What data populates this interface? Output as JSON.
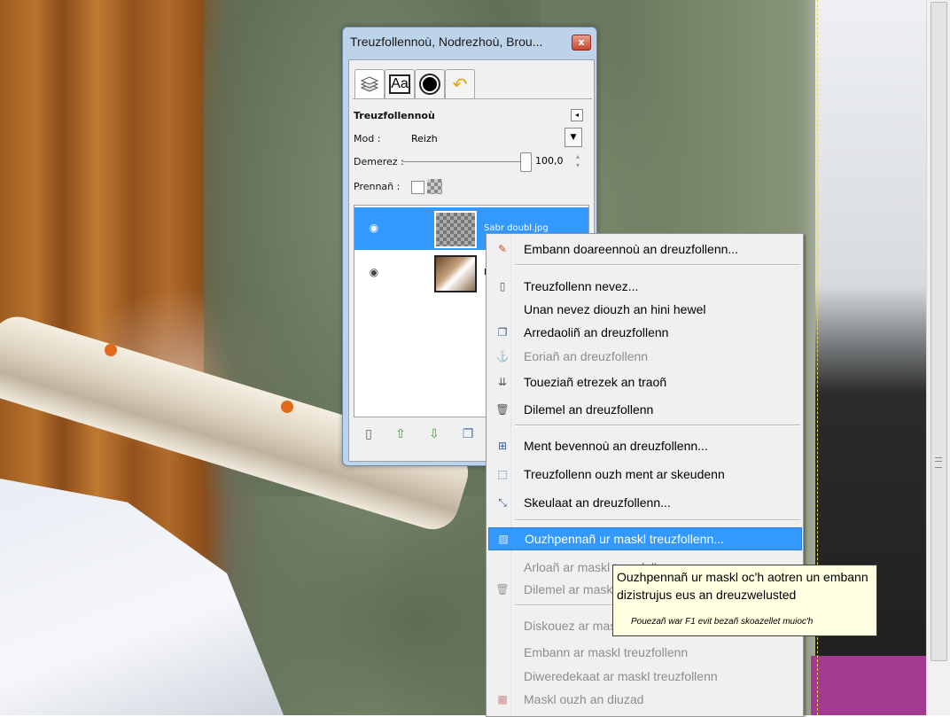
{
  "window": {
    "title": "Treuzfollennoù, Nodrezhoù, Brou...",
    "close_label": "x"
  },
  "tabs": [
    {
      "icon": "layers-icon"
    },
    {
      "icon": "text-icon",
      "label": "Aa"
    },
    {
      "icon": "brush-icon"
    },
    {
      "icon": "undo-icon"
    }
  ],
  "layers_panel": {
    "title": "Treuzfollennoù",
    "mode_label": "Mod :",
    "mode_value": "Reizh",
    "opacity_label": "Demerez :",
    "opacity_value": "100,0",
    "lock_label": "Prennañ :",
    "layers": [
      {
        "name": "Sabr doubl.jpg",
        "selected": true,
        "visible": true
      },
      {
        "name": "D",
        "selected": false,
        "visible": true
      }
    ]
  },
  "context_menu": {
    "items": [
      {
        "label": "Embann doareennoù an dreuzfollenn...",
        "icon": "edit-icon",
        "disabled": false
      },
      {
        "type": "separator"
      },
      {
        "label": "Treuzfollenn nevez...",
        "icon": "new-page-icon",
        "disabled": false
      },
      {
        "label": "Unan nevez diouzh an hini hewel",
        "icon": "",
        "disabled": false
      },
      {
        "label": "Arredaoliñ an dreuzfollenn",
        "icon": "duplicate-icon",
        "disabled": false
      },
      {
        "label": "Eoriañ an dreuzfollenn",
        "icon": "anchor-icon",
        "disabled": true
      },
      {
        "label": "Toueziañ etrezek an traoñ",
        "icon": "merge-down-icon",
        "disabled": false
      },
      {
        "label": "Dilemel an dreuzfollenn",
        "icon": "delete-icon",
        "disabled": false
      },
      {
        "type": "separator"
      },
      {
        "label": "Ment bevennoù an dreuzfollenn...",
        "icon": "boundary-size-icon",
        "disabled": false
      },
      {
        "label": "Treuzfollenn ouzh ment ar skeudenn",
        "icon": "fit-image-icon",
        "disabled": false
      },
      {
        "label": "Skeulaat an dreuzfollenn...",
        "icon": "scale-icon",
        "disabled": false
      },
      {
        "type": "separator"
      },
      {
        "label": "Ouzhpennañ ur maskl treuzfollenn...",
        "icon": "add-mask-icon",
        "disabled": false,
        "highlighted": true
      },
      {
        "label": "Arloañ ar maskl treuzfollenn",
        "icon": "",
        "disabled": true
      },
      {
        "label": "Dilemel ar maskl treuzfollenn",
        "icon": "delete-icon",
        "disabled": true
      },
      {
        "type": "separator"
      },
      {
        "label": "Diskouez ar maskl treuzfollenn",
        "icon": "",
        "disabled": true
      },
      {
        "label": "Embann ar maskl treuzfollenn",
        "icon": "",
        "disabled": true
      },
      {
        "label": "Diweredekaat ar maskl treuzfollenn",
        "icon": "",
        "disabled": true
      },
      {
        "label": "Maskl ouzh an diuzad",
        "icon": "mask-to-selection-icon",
        "disabled": true
      }
    ]
  },
  "tooltip": {
    "text": "Ouzhpennañ ur maskl oc'h aotren un embann dizistrujus eus an dreuzwelusted",
    "help": "Pouezañ war F1 evit bezañ skoazellet muioc'h"
  }
}
